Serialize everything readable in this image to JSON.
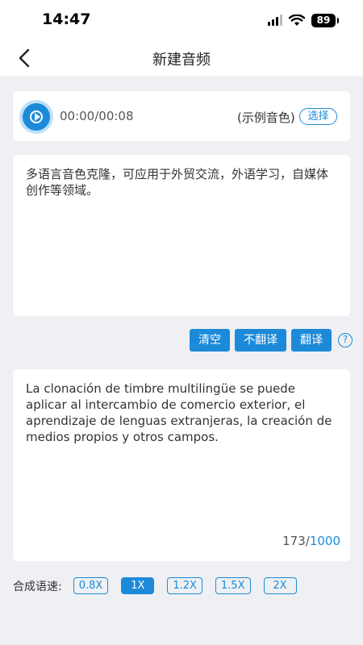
{
  "status_bar": {
    "time": "14:47",
    "battery": "89"
  },
  "nav": {
    "title": "新建音频"
  },
  "audio": {
    "time": "00:00/00:08",
    "sample_label": "(示例音色)",
    "select_label": "选择"
  },
  "source_text": "多语言音色克隆，可应用于外贸交流，外语学习，自媒体创作等领域。",
  "actions": {
    "clear": "清空",
    "no_translate": "不翻译",
    "translate": "翻译",
    "help": "?"
  },
  "translated_text": "La clonación de timbre multilingüe se puede aplicar al intercambio de comercio exterior, el aprendizaje de lenguas extranjeras, la creación de medios propios y otros campos.",
  "counter": {
    "current": "173/",
    "max": "1000"
  },
  "speed": {
    "label": "合成语速:",
    "options": [
      "0.8X",
      "1X",
      "1.2X",
      "1.5X",
      "2X"
    ],
    "selected": "1X"
  },
  "colors": {
    "accent": "#1c8ad9",
    "background": "#eef0f3"
  }
}
